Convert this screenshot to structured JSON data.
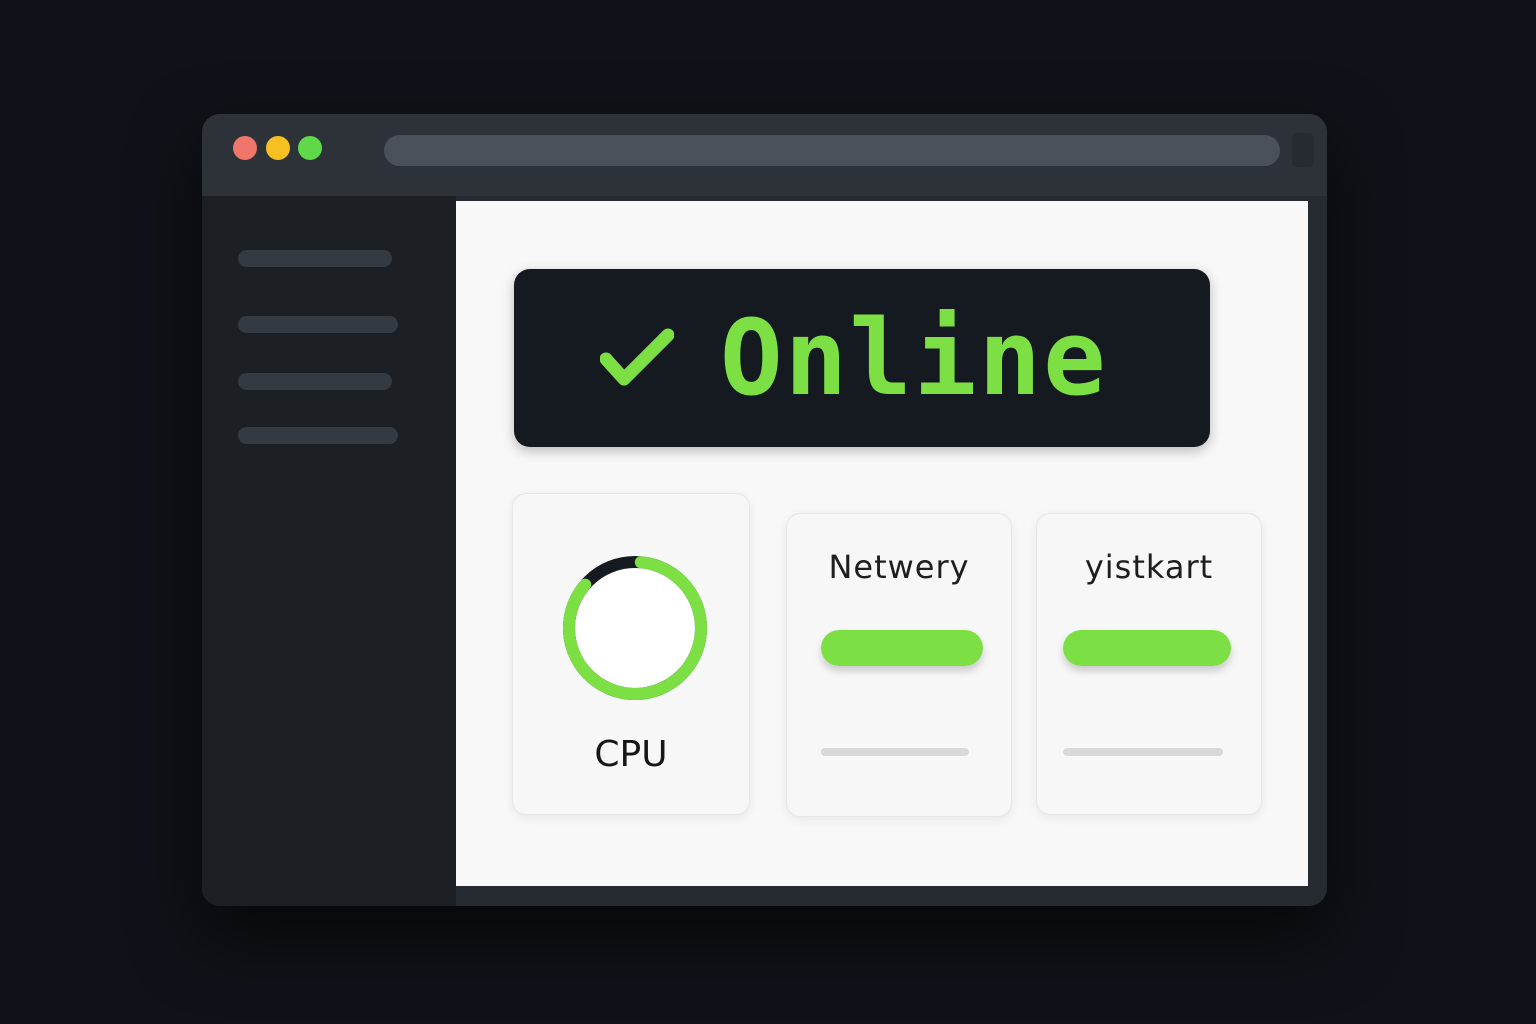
{
  "colors": {
    "accent": "#7ce045",
    "close_dot": "#f0756a",
    "minimize_dot": "#f6c120",
    "maximize_dot": "#5fd94a",
    "gauge_track": "#151a20"
  },
  "window": {
    "controls": [
      {
        "name": "close",
        "color": "#f0756a"
      },
      {
        "name": "minimize",
        "color": "#f6c120"
      },
      {
        "name": "maximize",
        "color": "#5fd94a"
      }
    ]
  },
  "status": {
    "icon": "check-icon",
    "text": "Online"
  },
  "cards": {
    "cpu": {
      "label": "CPU",
      "gauge_fraction": 0.85
    },
    "network": {
      "title": "Netwery",
      "bar_fraction": 1.0
    },
    "third": {
      "title": "yistkart",
      "bar_fraction": 1.0
    }
  }
}
